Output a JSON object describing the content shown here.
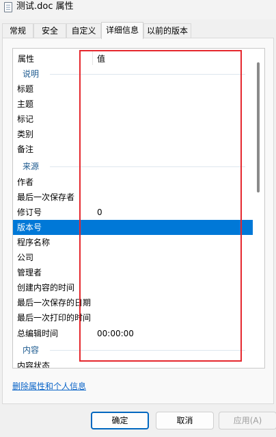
{
  "window": {
    "title": "测试.doc 属性"
  },
  "tabs": [
    "常规",
    "安全",
    "自定义",
    "详细信息",
    "以前的版本"
  ],
  "list": {
    "header_name": "属性",
    "header_value": "值",
    "groups": {
      "description": "说明",
      "origin": "来源",
      "content": "内容"
    },
    "rows": [
      {
        "name": "标题",
        "value": ""
      },
      {
        "name": "主题",
        "value": ""
      },
      {
        "name": "标记",
        "value": ""
      },
      {
        "name": "类别",
        "value": ""
      },
      {
        "name": "备注",
        "value": ""
      },
      {
        "name": "作者",
        "value": ""
      },
      {
        "name": "最后一次保存者",
        "value": ""
      },
      {
        "name": "修订号",
        "value": "0"
      },
      {
        "name": "版本号",
        "value": ""
      },
      {
        "name": "程序名称",
        "value": ""
      },
      {
        "name": "公司",
        "value": ""
      },
      {
        "name": "管理者",
        "value": ""
      },
      {
        "name": "创建内容的时间",
        "value": ""
      },
      {
        "name": "最后一次保存的日期",
        "value": ""
      },
      {
        "name": "最后一次打印的时间",
        "value": ""
      },
      {
        "name": "总编辑时间",
        "value": "00:00:00"
      },
      {
        "name": "内容状态",
        "value": ""
      }
    ],
    "selected_row": "版本号"
  },
  "footer": {
    "remove_link": "删除属性和个人信息",
    "ok": "确定",
    "cancel": "取消",
    "apply": "应用(A)"
  },
  "colors": {
    "selection": "#0078d7",
    "highlight_box": "#e5272d",
    "link": "#0a64c8"
  }
}
